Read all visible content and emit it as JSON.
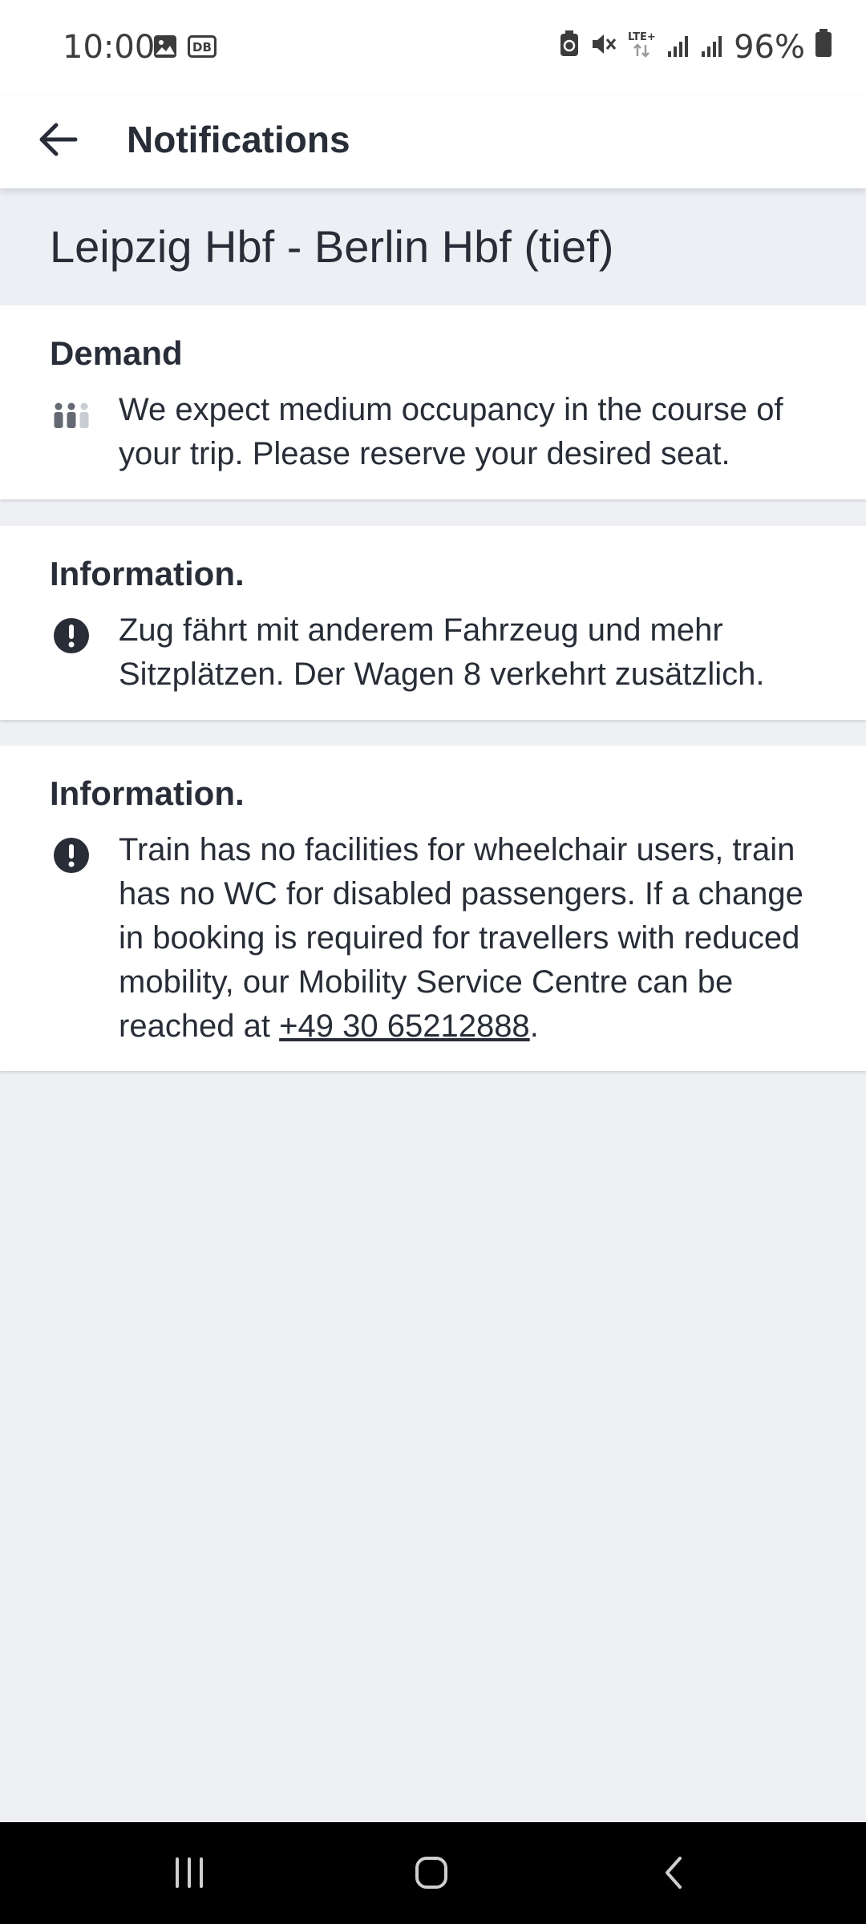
{
  "status_bar": {
    "time": "10:00",
    "battery": "96%",
    "network": "LTE+"
  },
  "app_bar": {
    "title": "Notifications"
  },
  "route": {
    "title": "Leipzig Hbf - Berlin Hbf (tief)"
  },
  "cards": [
    {
      "title": "Demand",
      "icon": "occupancy-icon",
      "text": "We expect medium occupancy in the course of your trip. Please reserve your desired seat."
    },
    {
      "title": "Information.",
      "icon": "exclamation-icon",
      "text": "Zug fährt mit anderem Fahrzeug und mehr Sitzplätzen. Der Wagen 8 verkehrt zusätzlich."
    },
    {
      "title": "Information.",
      "icon": "exclamation-icon",
      "text_before_link": "Train has no facilities for wheelchair users, train has no WC for disabled passengers. If a change in booking is required for travellers with reduced mobility, our Mobility Service Centre can be reached at ",
      "link": "+49 30 65212888",
      "text_after_link": "."
    }
  ],
  "colors": {
    "background": "#eef0f4",
    "text": "#282d37",
    "card": "#ffffff"
  }
}
